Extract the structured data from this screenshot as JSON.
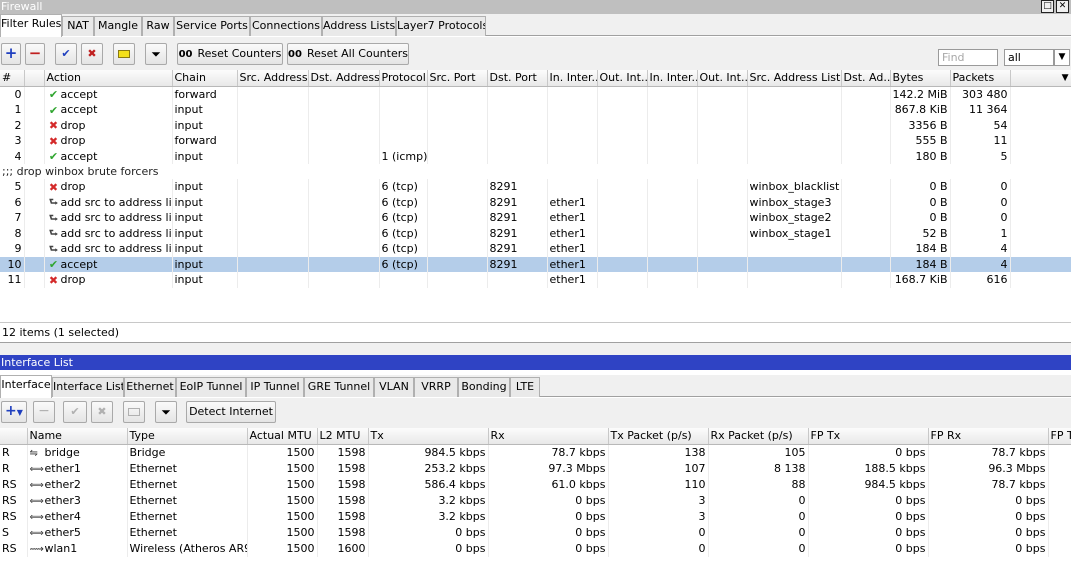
{
  "firewall": {
    "title": "Firewall",
    "tabs": [
      "Filter Rules",
      "NAT",
      "Mangle",
      "Raw",
      "Service Ports",
      "Connections",
      "Address Lists",
      "Layer7 Protocols"
    ],
    "toolbar": {
      "reset_counters": "Reset Counters",
      "reset_all_counters": "Reset All Counters",
      "oo": "00",
      "find_placeholder": "Find",
      "filter_value": "all"
    },
    "columns": [
      "#",
      "",
      "Action",
      "Chain",
      "Src. Address",
      "Dst. Address",
      "Protocol",
      "Src. Port",
      "Dst. Port",
      "In. Inter...",
      "Out. Int...",
      "In. Inter...",
      "Out. Int...",
      "Src. Address List",
      "Dst. Ad...",
      "Bytes",
      "Packets"
    ],
    "rows": [
      {
        "num": "0",
        "icon": "check",
        "action": "accept",
        "chain": "forward",
        "protocol": "",
        "dst_port": "",
        "in_iface": "",
        "src_list": "",
        "bytes": "142.2 MiB",
        "packets": "303 480"
      },
      {
        "num": "1",
        "icon": "check",
        "action": "accept",
        "chain": "input",
        "protocol": "",
        "dst_port": "",
        "in_iface": "",
        "src_list": "",
        "bytes": "867.8 KiB",
        "packets": "11 364"
      },
      {
        "num": "2",
        "icon": "x",
        "action": "drop",
        "chain": "input",
        "protocol": "",
        "dst_port": "",
        "in_iface": "",
        "src_list": "",
        "bytes": "3356 B",
        "packets": "54"
      },
      {
        "num": "3",
        "icon": "x",
        "action": "drop",
        "chain": "forward",
        "protocol": "",
        "dst_port": "",
        "in_iface": "",
        "src_list": "",
        "bytes": "555 B",
        "packets": "11"
      },
      {
        "num": "4",
        "icon": "check",
        "action": "accept",
        "chain": "input",
        "protocol": "1 (icmp)",
        "dst_port": "",
        "in_iface": "",
        "src_list": "",
        "bytes": "180 B",
        "packets": "5"
      },
      {
        "comment": ";;; drop winbox brute forcers"
      },
      {
        "num": "5",
        "icon": "x",
        "action": "drop",
        "chain": "input",
        "protocol": "6 (tcp)",
        "dst_port": "8291",
        "in_iface": "",
        "src_list": "winbox_blacklist",
        "bytes": "0 B",
        "packets": "0"
      },
      {
        "num": "6",
        "icon": "arrow",
        "action": "add src to address list",
        "chain": "input",
        "protocol": "6 (tcp)",
        "dst_port": "8291",
        "in_iface": "ether1",
        "src_list": "winbox_stage3",
        "bytes": "0 B",
        "packets": "0"
      },
      {
        "num": "7",
        "icon": "arrow",
        "action": "add src to address list",
        "chain": "input",
        "protocol": "6 (tcp)",
        "dst_port": "8291",
        "in_iface": "ether1",
        "src_list": "winbox_stage2",
        "bytes": "0 B",
        "packets": "0"
      },
      {
        "num": "8",
        "icon": "arrow",
        "action": "add src to address list",
        "chain": "input",
        "protocol": "6 (tcp)",
        "dst_port": "8291",
        "in_iface": "ether1",
        "src_list": "winbox_stage1",
        "bytes": "52 B",
        "packets": "1"
      },
      {
        "num": "9",
        "icon": "arrow",
        "action": "add src to address list",
        "chain": "input",
        "protocol": "6 (tcp)",
        "dst_port": "8291",
        "in_iface": "ether1",
        "src_list": "",
        "bytes": "184 B",
        "packets": "4"
      },
      {
        "num": "10",
        "icon": "check",
        "action": "accept",
        "chain": "input",
        "protocol": "6 (tcp)",
        "dst_port": "8291",
        "in_iface": "ether1",
        "src_list": "",
        "bytes": "184 B",
        "packets": "4",
        "selected": true
      },
      {
        "num": "11",
        "icon": "x",
        "action": "drop",
        "chain": "input",
        "protocol": "",
        "dst_port": "",
        "in_iface": "ether1",
        "src_list": "",
        "bytes": "168.7 KiB",
        "packets": "616"
      }
    ],
    "status": "12 items (1 selected)"
  },
  "interfaces": {
    "title": "Interface List",
    "tabs": [
      "Interface",
      "Interface List",
      "Ethernet",
      "EoIP Tunnel",
      "IP Tunnel",
      "GRE Tunnel",
      "VLAN",
      "VRRP",
      "Bonding",
      "LTE"
    ],
    "toolbar": {
      "detect_internet": "Detect Internet"
    },
    "columns": [
      "",
      "Name",
      "Type",
      "Actual MTU",
      "L2 MTU",
      "Tx",
      "Rx",
      "Tx Packet (p/s)",
      "Rx Packet (p/s)",
      "FP Tx",
      "FP Rx",
      "FP T"
    ],
    "rows": [
      {
        "flag": "R",
        "icon": "bridge",
        "name": "bridge",
        "type": "Bridge",
        "mtu": "1500",
        "l2mtu": "1598",
        "tx": "984.5 kbps",
        "rx": "78.7 kbps",
        "txp": "138",
        "rxp": "105",
        "fptx": "0 bps",
        "fprx": "78.7 kbps"
      },
      {
        "flag": "R",
        "icon": "ether",
        "name": "ether1",
        "type": "Ethernet",
        "mtu": "1500",
        "l2mtu": "1598",
        "tx": "253.2 kbps",
        "rx": "97.3 Mbps",
        "txp": "107",
        "rxp": "8 138",
        "fptx": "188.5 kbps",
        "fprx": "96.3 Mbps"
      },
      {
        "flag": "RS",
        "icon": "ether",
        "name": "ether2",
        "type": "Ethernet",
        "mtu": "1500",
        "l2mtu": "1598",
        "tx": "586.4 kbps",
        "rx": "61.0 kbps",
        "txp": "110",
        "rxp": "88",
        "fptx": "984.5 kbps",
        "fprx": "78.7 kbps"
      },
      {
        "flag": "RS",
        "icon": "ether",
        "name": "ether3",
        "type": "Ethernet",
        "mtu": "1500",
        "l2mtu": "1598",
        "tx": "3.2 kbps",
        "rx": "0 bps",
        "txp": "3",
        "rxp": "0",
        "fptx": "0 bps",
        "fprx": "0 bps"
      },
      {
        "flag": "RS",
        "icon": "ether",
        "name": "ether4",
        "type": "Ethernet",
        "mtu": "1500",
        "l2mtu": "1598",
        "tx": "3.2 kbps",
        "rx": "0 bps",
        "txp": "3",
        "rxp": "0",
        "fptx": "0 bps",
        "fprx": "0 bps"
      },
      {
        "flag": "S",
        "icon": "ether",
        "name": "ether5",
        "type": "Ethernet",
        "mtu": "1500",
        "l2mtu": "1598",
        "tx": "0 bps",
        "rx": "0 bps",
        "txp": "0",
        "rxp": "0",
        "fptx": "0 bps",
        "fprx": "0 bps"
      },
      {
        "flag": "RS",
        "icon": "wlan",
        "name": "wlan1",
        "type": "Wireless (Atheros AR9...",
        "mtu": "1500",
        "l2mtu": "1600",
        "tx": "0 bps",
        "rx": "0 bps",
        "txp": "0",
        "rxp": "0",
        "fptx": "0 bps",
        "fprx": "0 bps"
      }
    ]
  },
  "colors": {
    "selected_row": "#b4cde9",
    "iface_title_bar": "#2f43c4",
    "fw_title_bar": "#bfbfbf",
    "accept_icon": "#2fa52f",
    "drop_icon": "#d42a2a"
  }
}
